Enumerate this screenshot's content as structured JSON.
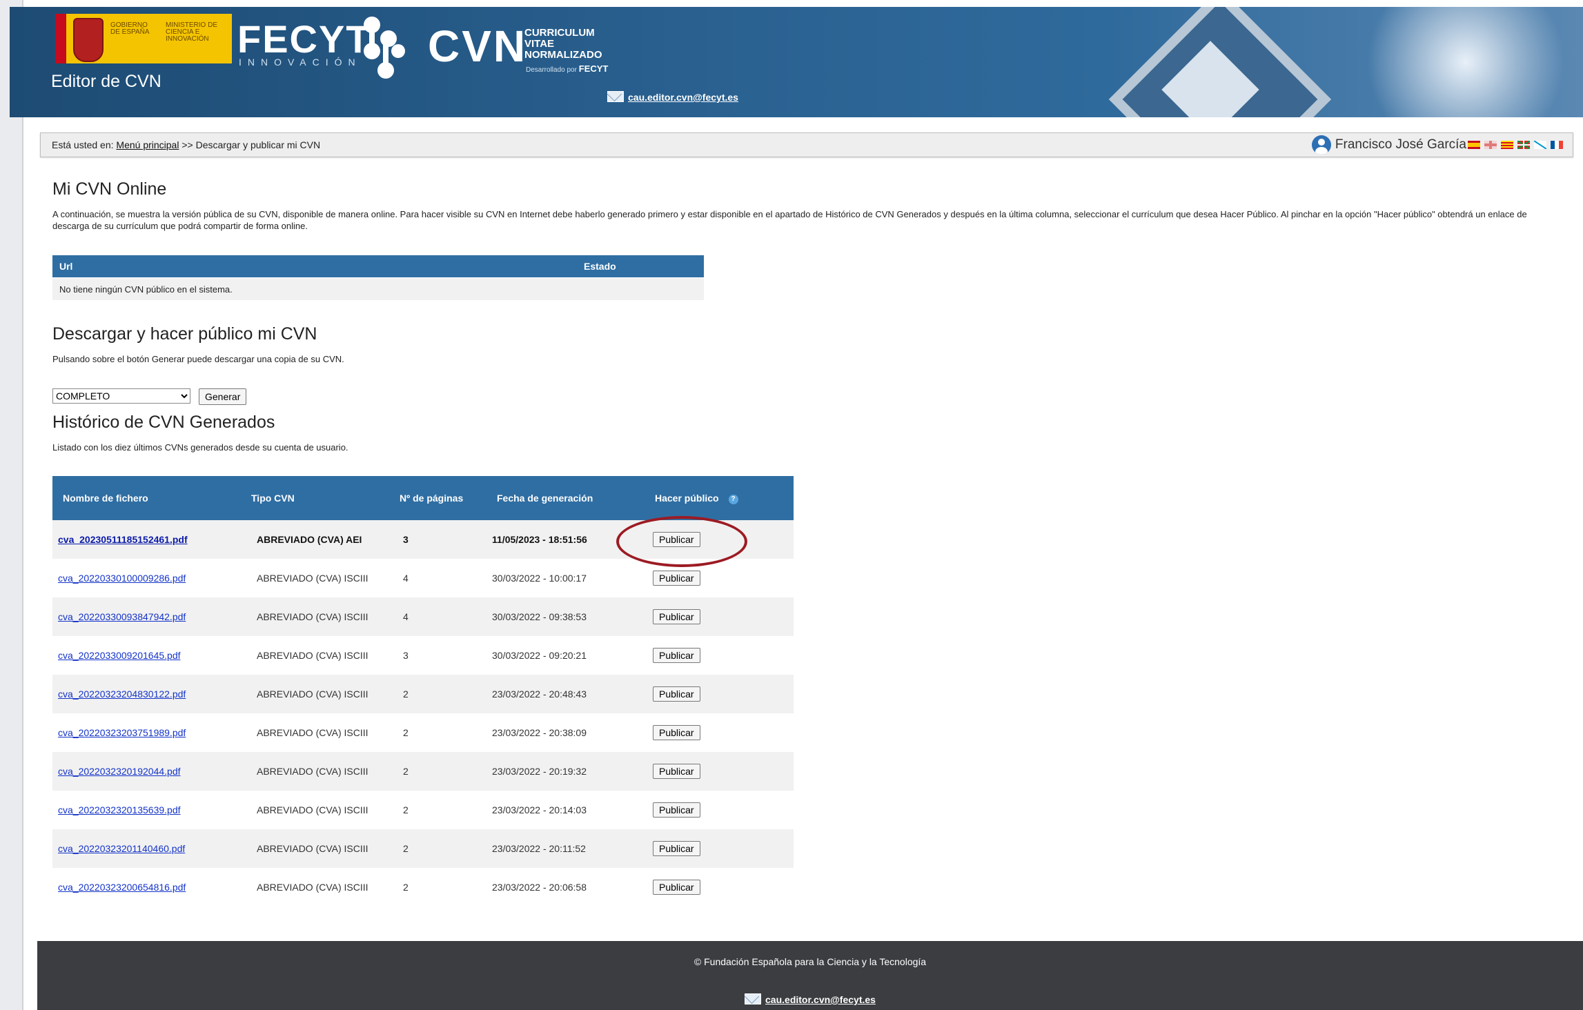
{
  "header": {
    "app_title": "Editor de CVN",
    "gov_logo": {
      "line1": "GOBIERNO DE ESPAÑA",
      "line2": "MINISTERIO DE CIENCIA E INNOVACIÓN"
    },
    "fecyt": "FECYT",
    "fecyt_sub": "INNOVACIÓN",
    "cvn": "CVN",
    "cvn_lines": [
      "CURRICULUM",
      "VITAE",
      "NORMALIZADO"
    ],
    "cvn_dev_prefix": "Desarrollado por",
    "cvn_dev_brand": "FECYT",
    "email": "cau.editor.cvn@fecyt.es"
  },
  "breadcrumb": {
    "prefix": "Está usted en:",
    "link": "Menú principal",
    "current": ">> Descargar y publicar mi CVN"
  },
  "user": {
    "name": "Francisco José García"
  },
  "online": {
    "title": "Mi CVN Online",
    "description": "A continuación, se muestra la versión pública de su CVN, disponible de manera online. Para hacer visible su CVN en Internet debe haberlo generado primero y estar disponible en el apartado de Histórico de CVN Generados y después en la última columna, seleccionar el currículum que desea Hacer Público. Al pinchar en la opción \"Hacer público\" obtendrá un enlace de descarga de su currículum que podrá compartir de forma online.",
    "table_headers": [
      "Url",
      "Estado"
    ],
    "empty_message": "No tiene ningún CVN público en el sistema."
  },
  "download": {
    "title": "Descargar y hacer público mi CVN",
    "description": "Pulsando sobre el botón Generar puede descargar una copia de su CVN.",
    "select_value": "COMPLETO",
    "generate_label": "Generar"
  },
  "history": {
    "title": "Histórico de CVN Generados",
    "description": "Listado con los diez últimos CVNs generados desde su cuenta de usuario.",
    "headers": [
      "Nombre de fichero",
      "Tipo CVN",
      "Nº de páginas",
      "Fecha de generación",
      "Hacer público"
    ],
    "help_icon": "?",
    "publish_label": "Publicar",
    "rows": [
      {
        "file": "cva_20230511185152461.pdf",
        "type": "ABREVIADO (CVA) AEI",
        "pages": "3",
        "date": "11/05/2023 - 18:51:56"
      },
      {
        "file": "cva_20220330100009286.pdf",
        "type": "ABREVIADO (CVA) ISCIII",
        "pages": "4",
        "date": "30/03/2022 - 10:00:17"
      },
      {
        "file": "cva_20220330093847942.pdf",
        "type": "ABREVIADO (CVA) ISCIII",
        "pages": "4",
        "date": "30/03/2022 - 09:38:53"
      },
      {
        "file": "cva_2022033009201645.pdf",
        "type": "ABREVIADO (CVA) ISCIII",
        "pages": "3",
        "date": "30/03/2022 - 09:20:21"
      },
      {
        "file": "cva_20220323204830122.pdf",
        "type": "ABREVIADO (CVA) ISCIII",
        "pages": "2",
        "date": "23/03/2022 - 20:48:43"
      },
      {
        "file": "cva_20220323203751989.pdf",
        "type": "ABREVIADO (CVA) ISCIII",
        "pages": "2",
        "date": "23/03/2022 - 20:38:09"
      },
      {
        "file": "cva_2022032320192044.pdf",
        "type": "ABREVIADO (CVA) ISCIII",
        "pages": "2",
        "date": "23/03/2022 - 20:19:32"
      },
      {
        "file": "cva_2022032320135639.pdf",
        "type": "ABREVIADO (CVA) ISCIII",
        "pages": "2",
        "date": "23/03/2022 - 20:14:03"
      },
      {
        "file": "cva_20220323201140460.pdf",
        "type": "ABREVIADO (CVA) ISCIII",
        "pages": "2",
        "date": "23/03/2022 - 20:11:52"
      },
      {
        "file": "cva_20220323200654816.pdf",
        "type": "ABREVIADO (CVA) ISCIII",
        "pages": "2",
        "date": "23/03/2022 - 20:06:58"
      }
    ]
  },
  "footer": {
    "copyright": "© Fundación Española para la Ciencia y la Tecnología",
    "email": "cau.editor.cvn@fecyt.es"
  },
  "colors": {
    "header_blue": "#2a6191",
    "table_header": "#2f6ea3",
    "highlight": "#9c1b23",
    "footer": "#3b3d40"
  }
}
